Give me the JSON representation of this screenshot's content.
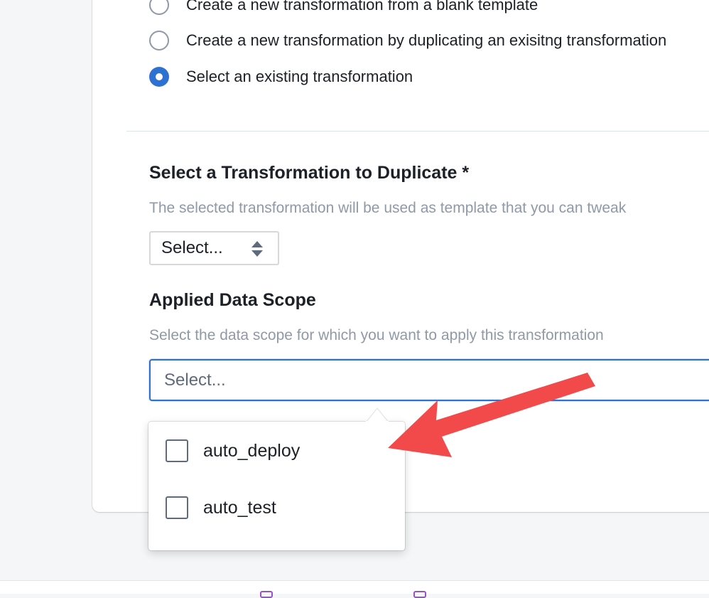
{
  "mode_options": [
    {
      "label": "Create a new transformation from a blank template",
      "checked": false
    },
    {
      "label": "Create a new transformation by duplicating an exisitng transformation",
      "checked": false
    },
    {
      "label": "Select an existing transformation",
      "checked": true
    }
  ],
  "duplicate_section": {
    "heading": "Select a Transformation to Duplicate *",
    "description": "The selected transformation will be used as template that you can tweak",
    "select_value": "Select..."
  },
  "scope_section": {
    "heading": "Applied Data Scope",
    "description": "Select the data scope for which you want to apply this transformation",
    "placeholder": "Select..."
  },
  "scope_dropdown": {
    "options": [
      {
        "label": "auto_deploy",
        "checked": false
      },
      {
        "label": "auto_test",
        "checked": false
      }
    ]
  },
  "colors": {
    "accent": "#2d72d2",
    "annotation_arrow": "#f24a4a"
  },
  "icons": {
    "select_caret": "double-caret-vertical-icon",
    "annotation": "red-arrow-icon"
  }
}
